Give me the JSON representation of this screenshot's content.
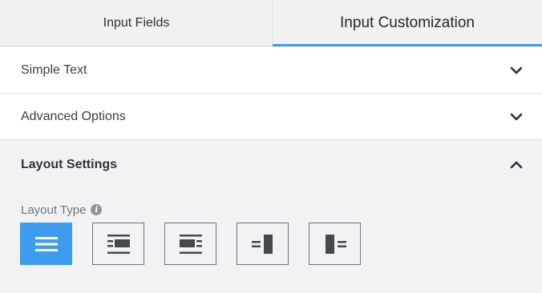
{
  "tabs": [
    {
      "label": "Input Fields",
      "active": false
    },
    {
      "label": "Input Customization",
      "active": true
    }
  ],
  "sections": {
    "simple_text": {
      "title": "Simple Text",
      "state": "collapsed",
      "icon": "chevron-down-icon"
    },
    "advanced_options": {
      "title": "Advanced Options",
      "state": "collapsed",
      "icon": "chevron-down-icon"
    },
    "layout_settings": {
      "title": "Layout Settings",
      "state": "expanded",
      "icon": "chevron-up-icon"
    }
  },
  "layout_type": {
    "label": "Layout Type",
    "info_icon": "i",
    "options": [
      {
        "name": "full-width-lines-icon",
        "selected": true
      },
      {
        "name": "label-left-icon",
        "selected": false
      },
      {
        "name": "label-right-icon",
        "selected": false
      },
      {
        "name": "block-right-icon",
        "selected": false
      },
      {
        "name": "block-left-icon",
        "selected": false
      }
    ]
  },
  "colors": {
    "accent": "#3d9cf0",
    "background": "#f1f2f4",
    "panel": "#ffffff"
  }
}
